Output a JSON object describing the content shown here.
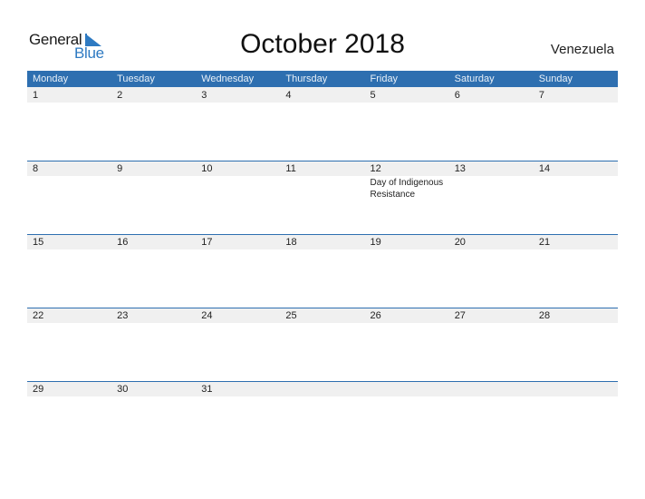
{
  "logo": {
    "word1": "General",
    "word2": "Blue"
  },
  "title": "October 2018",
  "country": "Venezuela",
  "colors": {
    "accent": "#2e6fb0",
    "logo_blue": "#2e7ac2",
    "day_strip": "#f0f0f0"
  },
  "weekdays": [
    "Monday",
    "Tuesday",
    "Wednesday",
    "Thursday",
    "Friday",
    "Saturday",
    "Sunday"
  ],
  "weeks": [
    {
      "days": [
        {
          "num": "1"
        },
        {
          "num": "2"
        },
        {
          "num": "3"
        },
        {
          "num": "4"
        },
        {
          "num": "5"
        },
        {
          "num": "6"
        },
        {
          "num": "7"
        }
      ]
    },
    {
      "days": [
        {
          "num": "8"
        },
        {
          "num": "9"
        },
        {
          "num": "10"
        },
        {
          "num": "11"
        },
        {
          "num": "12",
          "event": "Day of Indigenous Resistance"
        },
        {
          "num": "13"
        },
        {
          "num": "14"
        }
      ]
    },
    {
      "days": [
        {
          "num": "15"
        },
        {
          "num": "16"
        },
        {
          "num": "17"
        },
        {
          "num": "18"
        },
        {
          "num": "19"
        },
        {
          "num": "20"
        },
        {
          "num": "21"
        }
      ]
    },
    {
      "days": [
        {
          "num": "22"
        },
        {
          "num": "23"
        },
        {
          "num": "24"
        },
        {
          "num": "25"
        },
        {
          "num": "26"
        },
        {
          "num": "27"
        },
        {
          "num": "28"
        }
      ]
    },
    {
      "days": [
        {
          "num": "29"
        },
        {
          "num": "30"
        },
        {
          "num": "31"
        },
        {
          "num": ""
        },
        {
          "num": ""
        },
        {
          "num": ""
        },
        {
          "num": ""
        }
      ]
    }
  ]
}
